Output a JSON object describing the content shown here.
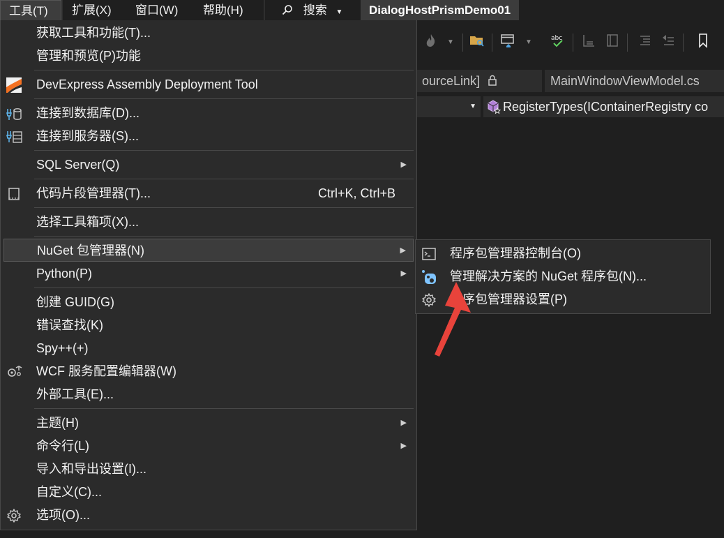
{
  "menubar": {
    "items": [
      "工具(T)",
      "扩展(X)",
      "窗口(W)",
      "帮助(H)"
    ],
    "search_label": "搜索",
    "solution_title": "DialogHostPrismDemo01"
  },
  "editor": {
    "tabs": [
      "ourceLink]",
      "MainWindowViewModel.cs"
    ],
    "member_dropdown": "RegisterTypes(IContainerRegistry co"
  },
  "tools_menu": {
    "items": [
      {
        "label": "获取工具和功能(T)...",
        "icon": null
      },
      {
        "label": "管理和预览(P)功能",
        "icon": null
      },
      {
        "label": "DevExpress Assembly Deployment Tool",
        "icon": "devexpress-icon"
      },
      {
        "label": "连接到数据库(D)...",
        "icon": "database-connect-icon"
      },
      {
        "label": "连接到服务器(S)...",
        "icon": "server-connect-icon"
      },
      {
        "label": "SQL Server(Q)",
        "submenu": true
      },
      {
        "label": "代码片段管理器(T)...",
        "shortcut": "Ctrl+K, Ctrl+B",
        "icon": "snippet-icon"
      },
      {
        "label": "选择工具箱项(X)..."
      },
      {
        "label": "NuGet 包管理器(N)",
        "submenu": true,
        "highlighted": true
      },
      {
        "label": "Python(P)",
        "submenu": true
      },
      {
        "label": "创建 GUID(G)"
      },
      {
        "label": "错误查找(K)"
      },
      {
        "label": "Spy++(+)"
      },
      {
        "label": "WCF 服务配置编辑器(W)",
        "icon": "wcf-config-icon"
      },
      {
        "label": "外部工具(E)..."
      },
      {
        "label": "主题(H)",
        "submenu": true
      },
      {
        "label": "命令行(L)",
        "submenu": true
      },
      {
        "label": "导入和导出设置(I)..."
      },
      {
        "label": "自定义(C)..."
      },
      {
        "label": "选项(O)...",
        "icon": "gear-icon"
      }
    ]
  },
  "nuget_submenu": {
    "items": [
      {
        "label": "程序包管理器控制台(O)",
        "icon": "console-icon"
      },
      {
        "label": "管理解决方案的 NuGet 程序包(N)...",
        "icon": "nuget-icon"
      },
      {
        "label": "程序包管理器设置(P)",
        "icon": "gear-icon"
      }
    ]
  },
  "colors": {
    "background": "#1f1f1f",
    "menu_bg": "#2b2b2b",
    "highlight_bg": "#3c3c3c",
    "annotation_arrow": "#e8433b"
  }
}
